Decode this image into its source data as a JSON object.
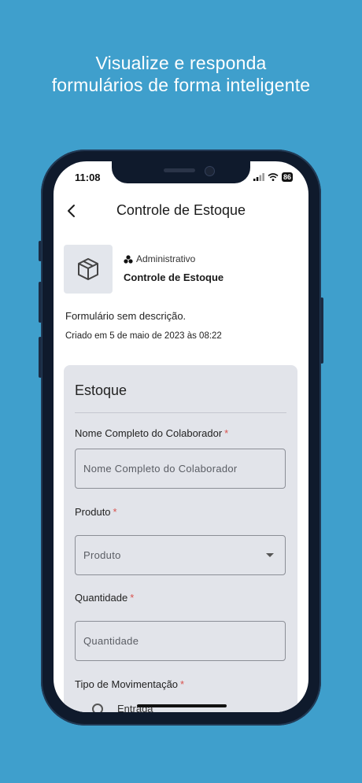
{
  "headline": {
    "line1": "Visualize e responda",
    "line2": "formulários de forma inteligente"
  },
  "status_bar": {
    "time": "11:08",
    "battery": "86"
  },
  "app_bar": {
    "title": "Controle de Estoque",
    "back_icon": "chevron-left-icon"
  },
  "form_header": {
    "icon": "box-icon",
    "owner_icon": "group-icon",
    "owner": "Administrativo",
    "name": "Controle de Estoque",
    "description": "Formulário sem descrição.",
    "created": "Criado em 5 de maio de 2023 às 08:22"
  },
  "section": {
    "title": "Estoque",
    "fields": [
      {
        "label": "Nome Completo do Colaborador",
        "required": "*",
        "placeholder": "Nome Completo do Colaborador",
        "type": "text"
      },
      {
        "label": "Produto",
        "required": "*",
        "placeholder": "Produto",
        "type": "dropdown"
      },
      {
        "label": "Quantidade",
        "required": "*",
        "placeholder": "Quantidade",
        "type": "text"
      },
      {
        "label": "Tipo de Movimentação",
        "required": "*",
        "type": "radio",
        "options": [
          "Entrada"
        ]
      }
    ]
  },
  "colors": {
    "background": "#3f9fcc",
    "card": "#e2e4ea",
    "required": "#d9534f"
  }
}
